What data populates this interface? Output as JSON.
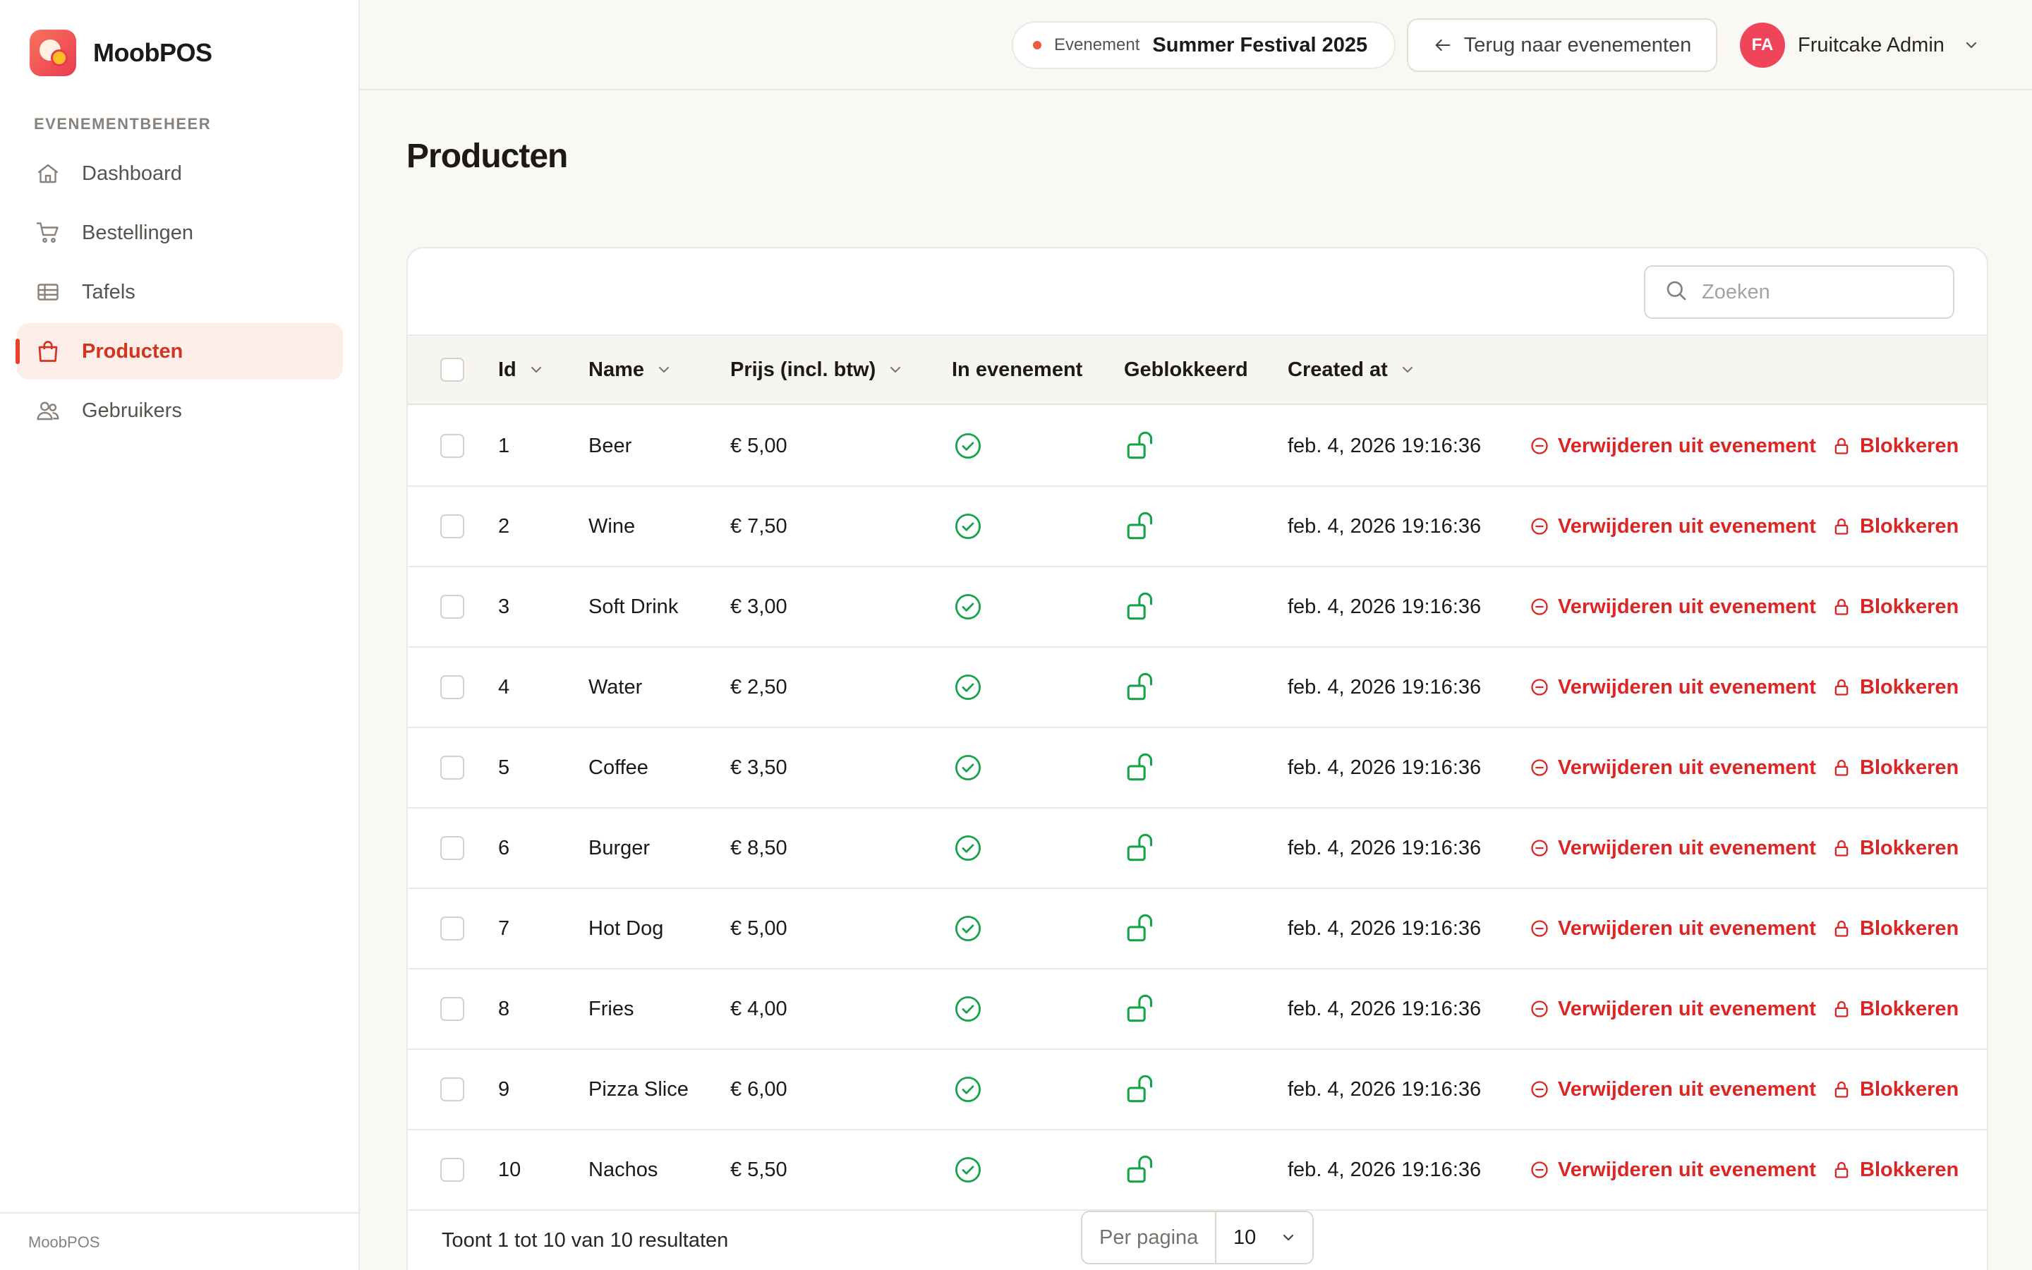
{
  "app": {
    "name": "MoobPOS",
    "footer": "MoobPOS"
  },
  "sidebar": {
    "section_title": "EVENEMENTBEHEER",
    "items": [
      {
        "label": "Dashboard",
        "icon": "home-icon",
        "active": false
      },
      {
        "label": "Bestellingen",
        "icon": "cart-icon",
        "active": false
      },
      {
        "label": "Tafels",
        "icon": "table-icon",
        "active": false
      },
      {
        "label": "Producten",
        "icon": "shopping-bag-icon",
        "active": true
      },
      {
        "label": "Gebruikers",
        "icon": "users-icon",
        "active": false
      }
    ]
  },
  "topbar": {
    "event_label": "Evenement",
    "event_name": "Summer Festival 2025",
    "back_label": "Terug naar evenementen",
    "user_initials": "FA",
    "user_name": "Fruitcake Admin"
  },
  "page": {
    "title": "Producten"
  },
  "search": {
    "placeholder": "Zoeken"
  },
  "table": {
    "columns": {
      "id": "Id",
      "name": "Name",
      "price": "Prijs (incl. btw)",
      "in_event": "In evenement",
      "blocked": "Geblokkeerd",
      "created": "Created at"
    },
    "rows": [
      {
        "id": "1",
        "name": "Beer",
        "price": "€ 5,00",
        "created": "feb. 4, 2026 19:16:36"
      },
      {
        "id": "2",
        "name": "Wine",
        "price": "€ 7,50",
        "created": "feb. 4, 2026 19:16:36"
      },
      {
        "id": "3",
        "name": "Soft Drink",
        "price": "€ 3,00",
        "created": "feb. 4, 2026 19:16:36"
      },
      {
        "id": "4",
        "name": "Water",
        "price": "€ 2,50",
        "created": "feb. 4, 2026 19:16:36"
      },
      {
        "id": "5",
        "name": "Coffee",
        "price": "€ 3,50",
        "created": "feb. 4, 2026 19:16:36"
      },
      {
        "id": "6",
        "name": "Burger",
        "price": "€ 8,50",
        "created": "feb. 4, 2026 19:16:36"
      },
      {
        "id": "7",
        "name": "Hot Dog",
        "price": "€ 5,00",
        "created": "feb. 4, 2026 19:16:36"
      },
      {
        "id": "8",
        "name": "Fries",
        "price": "€ 4,00",
        "created": "feb. 4, 2026 19:16:36"
      },
      {
        "id": "9",
        "name": "Pizza Slice",
        "price": "€ 6,00",
        "created": "feb. 4, 2026 19:16:36"
      },
      {
        "id": "10",
        "name": "Nachos",
        "price": "€ 5,50",
        "created": "feb. 4, 2026 19:16:36"
      }
    ],
    "actions": {
      "remove": "Verwijderen uit evenement",
      "block": "Blokkeren"
    }
  },
  "footer": {
    "result_text": "Toont 1 tot 10 van 10 resultaten",
    "per_page_label": "Per pagina",
    "per_page_value": "10"
  },
  "colors": {
    "accent": "#e8412e",
    "success": "#16a34a",
    "danger": "#dc2626"
  }
}
